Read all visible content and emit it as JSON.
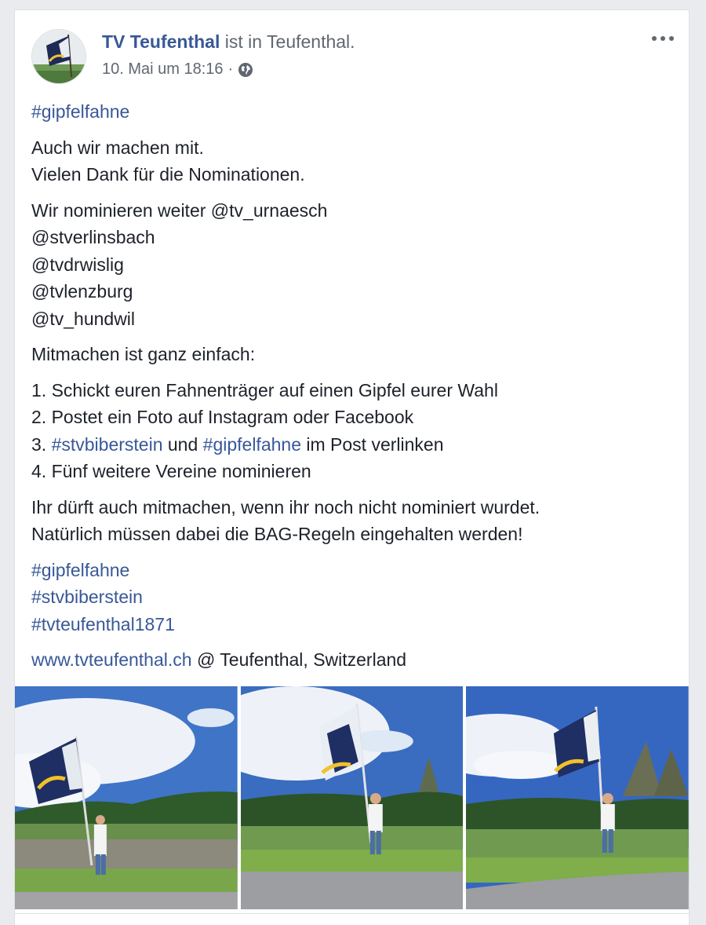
{
  "post": {
    "author": "TV Teufenthal",
    "checkin_text": "ist in",
    "location": "Teufenthal.",
    "timestamp": "10. Mai um 18:16",
    "meta_separator": "·",
    "privacy_icon": "globe-icon",
    "menu_icon": "more-options-icon"
  },
  "content": {
    "hashtag_top": "#gipfelfahne",
    "intro_line1": "Auch wir machen mit.",
    "intro_line2": "Vielen Dank für die Nominationen.",
    "nominate_prefix": "Wir nominieren weiter ",
    "nominations": [
      "@tv_urnaesch",
      "@stverlinsbach",
      "@tvdrwislig",
      "@tvlenzburg",
      "@tv_hundwil"
    ],
    "howto_heading": "Mitmachen ist ganz einfach:",
    "step1": "1. Schickt euren Fahnenträger auf einen Gipfel eurer Wahl",
    "step2": "2. Postet ein Foto auf Instagram oder Facebook",
    "step3_prefix": "3. ",
    "step3_tag1": "#stvbiberstein",
    "step3_mid": " und ",
    "step3_tag2": "#gipfelfahne",
    "step3_suffix": " im Post verlinken",
    "step4": "4. Fünf weitere Vereine nominieren",
    "note_line1": "Ihr dürft auch mitmachen, wenn ihr noch nicht nominiert wurdet.",
    "note_line2": "Natürlich müssen dabei die BAG-Regeln eingehalten werden!",
    "hashtags": [
      "#gipfelfahne",
      "#stvbiberstein",
      "#tvteufenthal1871"
    ],
    "website": "www.tvteufenthal.ch",
    "website_suffix": " @ Teufenthal, Switzerland"
  },
  "colors": {
    "link": "#385898",
    "text": "#1d2129",
    "meta": "#606770",
    "background": "#e9ebee"
  }
}
